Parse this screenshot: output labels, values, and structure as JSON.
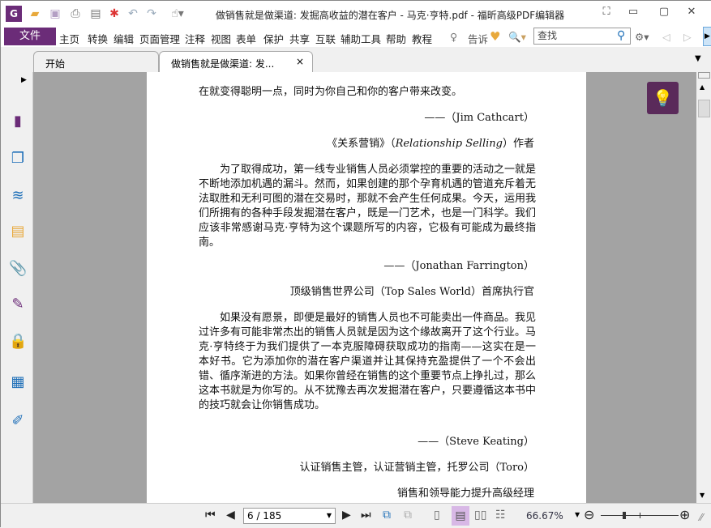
{
  "window": {
    "title": "做销售就是做渠道: 发掘高收益的潜在客户 - 马克·亨特.pdf - 福昕高级PDF编辑器"
  },
  "menu": {
    "file": "文件",
    "items": [
      "主页",
      "转换",
      "编辑",
      "页面管理",
      "注释",
      "视图",
      "表单",
      "保护",
      "共享",
      "互联",
      "辅助工具",
      "帮助",
      "教程"
    ],
    "tell": "告诉",
    "search_placeholder": "查找"
  },
  "tabs": [
    {
      "label": "开始"
    },
    {
      "label": "做销售就是做渠道: 发...",
      "close": "×"
    }
  ],
  "document": {
    "line1": "在就变得聪明一点，同时为你自己和你的客户带来改变。",
    "attr1": "——（Jim Cathcart）",
    "role1_pre": "《关系营销》（",
    "role1_italic": "Relationship Selling",
    "role1_post": "）作者",
    "para1": "为了取得成功，第一线专业销售人员必须掌控的重要的活动之一就是不断地添加机遇的漏斗。然而，如果创建的那个孕育机遇的管道充斥着无法取胜和无利可图的潜在交易时，那就不会产生任何成果。今天，运用我们所拥有的各种手段发掘潜在客户，既是一门艺术，也是一门科学。我们应该非常感谢马克·亨特为这个课题所写的内容，它极有可能成为最终指南。",
    "attr2": "——（Jonathan Farrington）",
    "role2": "顶级销售世界公司（Top Sales World）首席执行官",
    "para2": "如果没有愿景，即便是最好的销售人员也不可能卖出一件商品。我见过许多有可能非常杰出的销售人员就是因为这个缘故离开了这个行业。马克·亨特终于为我们提供了一本克服障碍获取成功的指南——这实在是一本好书。它为添加你的潜在客户渠道并让其保持充盈提供了一个不会出错、循序渐进的方法。如果你曾经在销售的这个重要节点上挣扎过，那么这本书就是为你写的。从不犹豫去再次发掘潜在客户，只要遵循这本书中的技巧就会让你销售成功。",
    "attr3": "——（Steve Keating）",
    "role3": "认证销售主管，认证营销主管，托罗公司（Toro）",
    "role4": "销售和领导能力提升高级经理"
  },
  "status": {
    "page": "6 / 185",
    "zoom": "66.67%",
    "zoom_fraction": 0.3
  },
  "colors": {
    "accent": "#6b2c78",
    "bulb_bg": "#5a2a5a"
  }
}
